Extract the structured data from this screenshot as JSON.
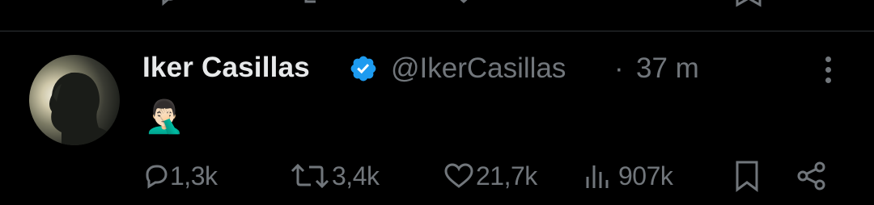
{
  "tweet": {
    "author_name": "Iker Casillas",
    "handle": "@IkerCasillas",
    "separator": "·",
    "timestamp": "37 m",
    "verified": true,
    "text": "🤦🏻‍♂️",
    "stats": {
      "replies": "1,3k",
      "reposts": "3,4k",
      "likes": "21,7k",
      "views": "907k"
    }
  },
  "icons": {
    "verified": "verified-badge-icon",
    "more": "more-vertical-icon",
    "reply": "reply-icon",
    "repost": "repost-icon",
    "like": "like-icon",
    "views": "views-icon",
    "bookmark": "bookmark-icon",
    "share": "share-icon"
  },
  "colors": {
    "background": "#000000",
    "primary_text": "#e7e9ea",
    "secondary_text": "#71767b",
    "verified_blue": "#1d9bf0",
    "divider": "#2f3336"
  }
}
